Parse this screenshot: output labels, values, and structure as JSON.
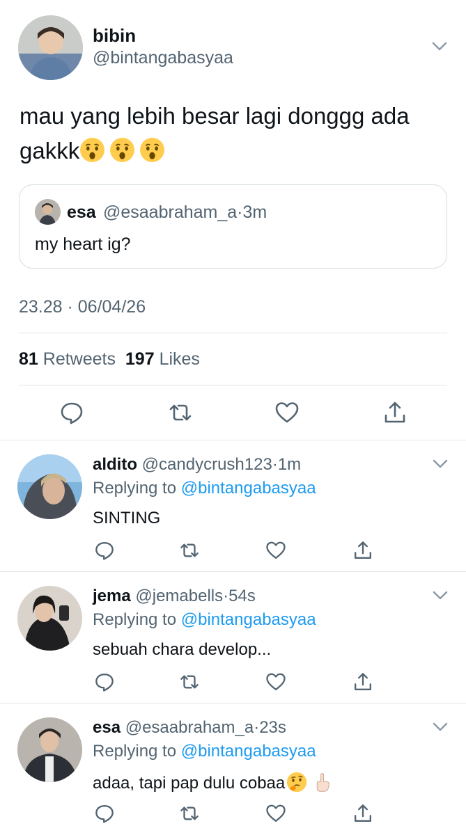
{
  "main_tweet": {
    "name": "bibin",
    "handle": "@bintangabasyaa",
    "text": "mau yang lebih besar lagi donggg ada gakkk",
    "emoji": [
      "astonished-face-emoji",
      "astonished-face-emoji",
      "astonished-face-emoji"
    ],
    "quote": {
      "name": "esa",
      "handle": "@esaabraham_a",
      "separator": "·",
      "time": "3m",
      "text": "my heart ig?"
    },
    "timestamp": "23.28 · 06/04/26",
    "retweets_count": "81",
    "retweets_label": "Retweets",
    "likes_count": "197",
    "likes_label": "Likes"
  },
  "replying_to_label": "Replying to",
  "replies": [
    {
      "name": "aldito",
      "handle": "@candycrush123",
      "separator": "·",
      "time": "1m",
      "replying_to": "@bintangabasyaa",
      "text": "SINTING"
    },
    {
      "name": "jema",
      "handle": "@jemabells",
      "separator": "·",
      "time": "54s",
      "replying_to": "@bintangabasyaa",
      "text": "sebuah chara develop..."
    },
    {
      "name": "esa",
      "handle": "@esaabraham_a",
      "separator": "·",
      "time": "23s",
      "replying_to": "@bintangabasyaa",
      "text": "adaa, tapi pap dulu cobaa",
      "emoji": [
        "thinking-face-emoji",
        "index-pointing-up-emoji"
      ]
    }
  ],
  "colors": {
    "text": "#0f1419",
    "secondary": "#536471",
    "link": "#1d9bf0",
    "divider": "#e1e6ea"
  },
  "icons": [
    "reply-icon",
    "retweet-icon",
    "like-icon",
    "share-icon",
    "chevron-down-icon"
  ]
}
